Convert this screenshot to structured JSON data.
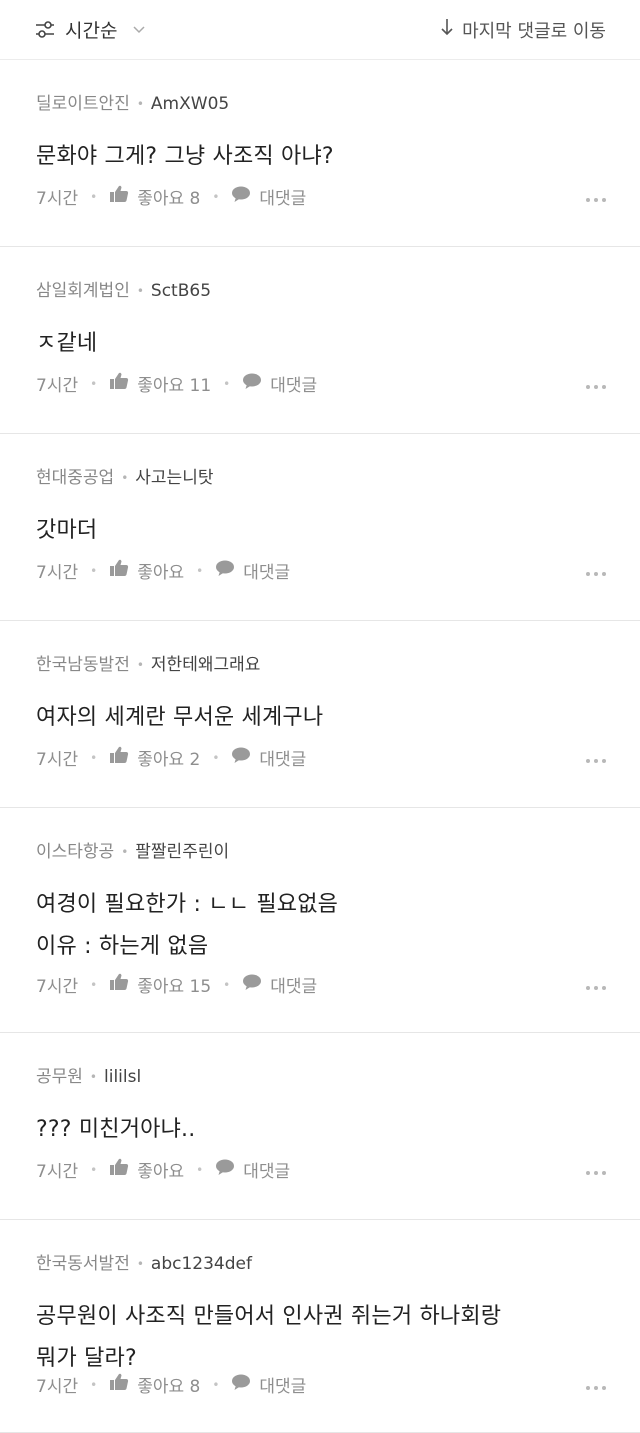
{
  "toolbar": {
    "sort_label": "시간순",
    "jump_label": "마지막 댓글로 이동",
    "sort_icon": "sliders-icon",
    "chevron_icon": "chevron-down-icon",
    "jump_icon": "arrow-down-icon"
  },
  "comments": [
    {
      "company": "딜로이트안진",
      "nickname": "AmXW05",
      "text": [
        "문화야 그게? 그냥 사조직 아냐?"
      ],
      "time": "7시간",
      "like_label": "좋아요 8",
      "reply_label": "대댓글"
    },
    {
      "company": "삼일회계법인",
      "nickname": "SctB65",
      "text": [
        "ㅈ같네"
      ],
      "time": "7시간",
      "like_label": "좋아요 11",
      "reply_label": "대댓글"
    },
    {
      "company": "현대중공업",
      "nickname": "사고는니탓",
      "text": [
        "갓마더"
      ],
      "time": "7시간",
      "like_label": "좋아요",
      "reply_label": "대댓글"
    },
    {
      "company": "한국남동발전",
      "nickname": "저한테왜그래요",
      "text": [
        "여자의 세계란 무서운 세계구나"
      ],
      "time": "7시간",
      "like_label": "좋아요 2",
      "reply_label": "대댓글"
    },
    {
      "company": "이스타항공",
      "nickname": "팔짤린주린이",
      "text": [
        "여경이 필요한가 : ㄴㄴ 필요없음",
        "이유 : 하는게 없음"
      ],
      "time": "7시간",
      "like_label": "좋아요 15",
      "reply_label": "대댓글"
    },
    {
      "company": "공무원",
      "nickname": "lililsl",
      "text": [
        "??? 미친거아냐.."
      ],
      "time": "7시간",
      "like_label": "좋아요",
      "reply_label": "대댓글"
    },
    {
      "company": "한국동서발전",
      "nickname": "abc1234def",
      "text": [
        "공무원이 사조직 만들어서 인사권 쥐는거 하나회랑",
        "뭐가 달라?"
      ],
      "time": "7시간",
      "like_label": "좋아요 8",
      "reply_label": "대댓글"
    }
  ],
  "colors": {
    "text": "#222222",
    "muted": "#8e8e8e",
    "divider": "#e6e6e6"
  }
}
